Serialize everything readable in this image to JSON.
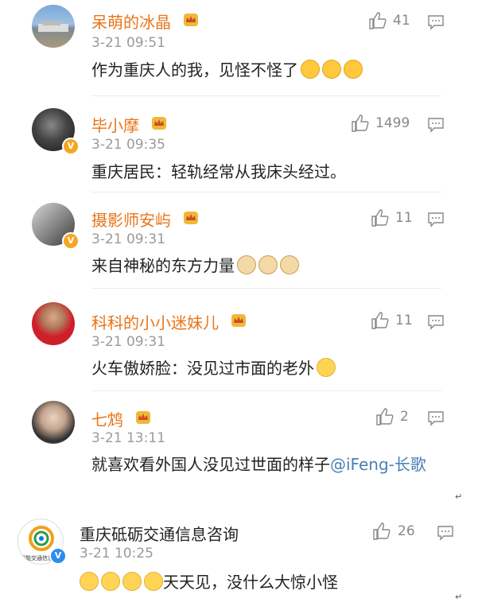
{
  "comments": [
    {
      "username": "呆萌的冰晶",
      "time": "3-21 09:51",
      "text": "作为重庆人的我，见怪不怪了",
      "likes": "41",
      "emoji": "laugh",
      "emoji_count": 3
    },
    {
      "username": "毕小摩",
      "time": "3-21 09:35",
      "text": "重庆居民：轻轨经常从我床头经过。",
      "likes": "1499",
      "verified": true
    },
    {
      "username": "摄影师安屿",
      "time": "3-21 09:31",
      "text": "来自神秘的东方力量",
      "likes": "11",
      "verified": true,
      "emoji": "dog",
      "emoji_count": 3
    },
    {
      "username": "科科的小小迷妹儿",
      "time": "3-21 09:31",
      "text": "火车傲娇脸：没见过市面的老外",
      "likes": "11",
      "emoji": "shrug",
      "emoji_count": 1
    },
    {
      "username": "七鸩",
      "time": "3-21 13:11",
      "text": "就喜欢看外国人没见过世面的样子",
      "mention": "@iFeng-长歌",
      "likes": "2"
    },
    {
      "username": "重庆砥砺交通信息咨询",
      "time": "3-21 10:25",
      "text": "天天见，没什么大惊小怪",
      "likes": "26",
      "verified": true,
      "avatar_label": "智能交通信息",
      "emoji": "shrug",
      "emoji_count": 4
    }
  ],
  "colors": {
    "username": "#e8751a",
    "time": "#9a9a9a",
    "mention": "#4a7fb5",
    "verified": "#f5a623"
  },
  "icons": [
    "thumbs-up-icon",
    "reply-comment-icon",
    "vip-crown-icon"
  ]
}
